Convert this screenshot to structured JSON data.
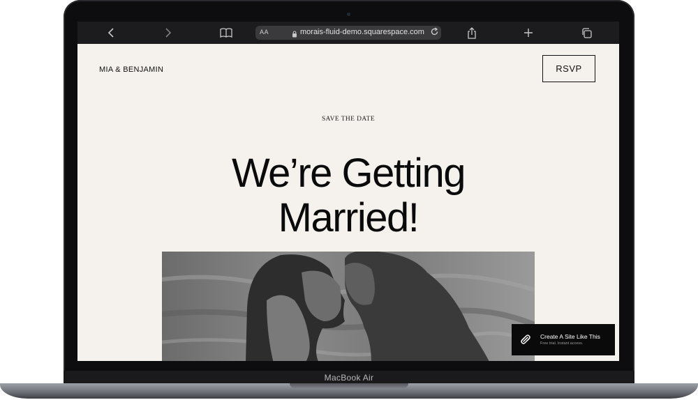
{
  "device": {
    "model_label": "MacBook Air"
  },
  "browser": {
    "text_size_label": "AA",
    "url": "morais-fluid-demo.squarespace.com",
    "icons": [
      "back-icon",
      "forward-icon",
      "bookmarks-icon",
      "lock-icon",
      "reload-icon",
      "share-icon",
      "new-tab-icon",
      "tabs-icon"
    ]
  },
  "site": {
    "title": "MIA & BENJAMIN",
    "rsvp_label": "RSVP",
    "kicker": "SAVE THE DATE",
    "headline_line1": "We’re Getting",
    "headline_line2": "Married!"
  },
  "badge": {
    "title": "Create A Site Like This",
    "subtitle": "Free trial. Instant access."
  },
  "colors": {
    "page_bg": "#f5f1ec",
    "text": "#111111",
    "toolbar_bg": "#1c1c1e",
    "badge_bg": "#0a0a0a"
  }
}
